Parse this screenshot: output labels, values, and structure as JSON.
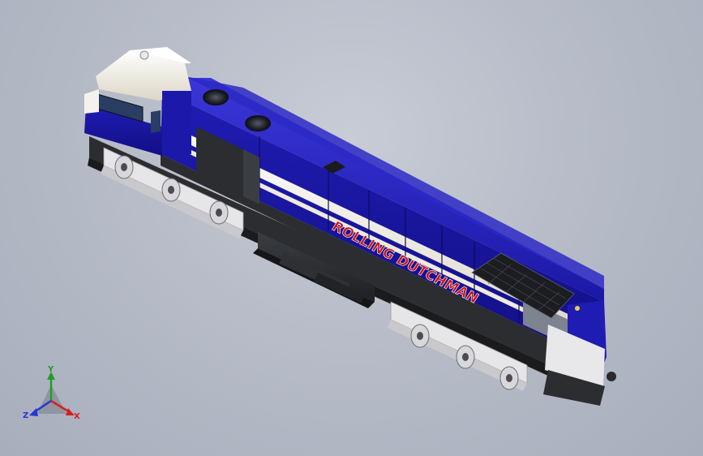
{
  "viewport": {
    "background_color": "#b9bec9"
  },
  "model": {
    "livery_text": "ROLLING DUTCHMAN",
    "colors": {
      "body_blue": "#1e1bb0",
      "body_blue_dark": "#110f7a",
      "cream": "#efeadc",
      "lettering_red": "#c8141e",
      "undercarriage_dark": "#2b2d30",
      "truck_light": "#e6e6e8"
    }
  },
  "triad": {
    "x_label": "X",
    "y_label": "Y",
    "z_label": "Z",
    "x_color": "#d42020",
    "y_color": "#1f9e2a",
    "z_color": "#2436d4"
  }
}
